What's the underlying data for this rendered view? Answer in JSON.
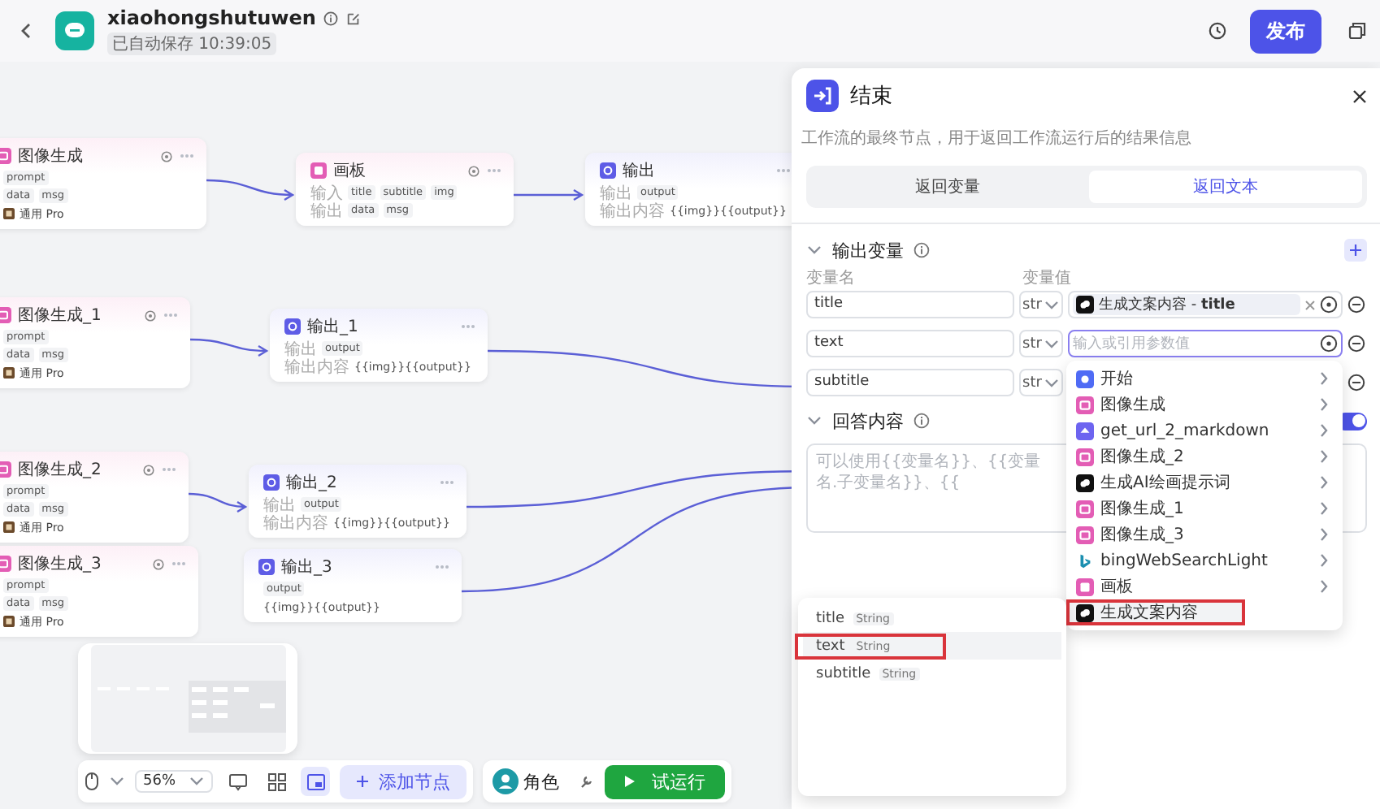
{
  "header": {
    "title": "xiaohongshutuwen",
    "save_status": "已自动保存 10:39:05",
    "publish_button": "发布"
  },
  "canvas": {
    "nodes": [
      {
        "kind": "image",
        "title": "图像生成",
        "rows": [
          {
            "kind": "tags",
            "tags": [
              "prompt"
            ]
          },
          {
            "kind": "tags",
            "tags": [
              "data",
              "msg"
            ]
          },
          {
            "kind": "model",
            "text": "通用 Pro"
          }
        ]
      },
      {
        "kind": "board",
        "title": "画板",
        "rows": [
          {
            "kind": "tags",
            "label": "输入",
            "tags": [
              "title",
              "subtitle",
              "img"
            ]
          },
          {
            "kind": "tags",
            "label": "输出",
            "tags": [
              "data",
              "msg"
            ]
          }
        ]
      },
      {
        "kind": "output",
        "title": "输出",
        "rows": [
          {
            "kind": "tags",
            "label": "输出",
            "tags": [
              "output"
            ]
          },
          {
            "kind": "text",
            "label": "输出内容",
            "text": "{{img}}{{output}}"
          }
        ]
      },
      {
        "kind": "image",
        "title": "图像生成_1",
        "rows": [
          {
            "kind": "tags",
            "tags": [
              "prompt"
            ]
          },
          {
            "kind": "tags",
            "tags": [
              "data",
              "msg"
            ]
          },
          {
            "kind": "model",
            "text": "通用 Pro"
          }
        ]
      },
      {
        "kind": "output",
        "title": "输出_1",
        "rows": [
          {
            "kind": "tags",
            "label": "输出",
            "tags": [
              "output"
            ]
          },
          {
            "kind": "text",
            "label": "输出内容",
            "text": "{{img}}{{output}}"
          }
        ]
      },
      {
        "kind": "image",
        "title": "图像生成_2",
        "rows": [
          {
            "kind": "tags",
            "tags": [
              "prompt"
            ]
          },
          {
            "kind": "tags",
            "tags": [
              "data",
              "msg"
            ]
          },
          {
            "kind": "model",
            "text": "通用 Pro"
          }
        ]
      },
      {
        "kind": "output",
        "title": "输出_2",
        "rows": [
          {
            "kind": "tags",
            "label": "输出",
            "tags": [
              "output"
            ]
          },
          {
            "kind": "text",
            "label": "输出内容",
            "text": "{{img}}{{output}}"
          }
        ]
      },
      {
        "kind": "image",
        "title": "图像生成_3",
        "rows": [
          {
            "kind": "tags",
            "tags": [
              "prompt"
            ]
          },
          {
            "kind": "tags",
            "tags": [
              "data",
              "msg"
            ]
          },
          {
            "kind": "model",
            "text": "通用 Pro"
          }
        ]
      },
      {
        "kind": "output",
        "title": "输出_3",
        "rows": [
          {
            "kind": "tags",
            "tags": [
              "output"
            ]
          },
          {
            "kind": "text",
            "text": "{{img}}{{output}}"
          }
        ]
      }
    ]
  },
  "panel": {
    "title": "结束",
    "description": "工作流的最终节点，用于返回工作流运行后的结果信息",
    "tabs": [
      {
        "label": "返回变量",
        "selected": false
      },
      {
        "label": "返回文本",
        "selected": true
      }
    ],
    "output_section": {
      "title": "输出变量",
      "expanded": true,
      "column_name": "变量名",
      "column_value": "变量值",
      "rows": [
        {
          "name": "title",
          "type": "str",
          "value": {
            "kind": "reference",
            "text": "生成文案内容 - **title**"
          }
        },
        {
          "name": "text",
          "type": "str",
          "value": {
            "kind": "input",
            "placeholder": "输入或引用参数值",
            "focused": true
          }
        },
        {
          "name": "subtitle",
          "type": "str"
        }
      ]
    },
    "answer_section": {
      "title": "回答内容",
      "expanded": true,
      "enabled": true,
      "placeholder": "可以使用{{变量名}}、{{变量名.子变量名}}、{{"
    }
  },
  "node_menu": [
    {
      "kind": "start",
      "label": "开始",
      "selected": false,
      "marked": false
    },
    {
      "kind": "image",
      "label": "图像生成",
      "selected": false,
      "marked": false
    },
    {
      "kind": "plugin",
      "label": "get_url_2_markdown",
      "selected": false,
      "marked": false
    },
    {
      "kind": "image",
      "label": "图像生成_2",
      "selected": false,
      "marked": false
    },
    {
      "kind": "llm",
      "label": "生成AI绘画提示词",
      "selected": false,
      "marked": false
    },
    {
      "kind": "image",
      "label": "图像生成_1",
      "selected": false,
      "marked": false
    },
    {
      "kind": "image",
      "label": "图像生成_3",
      "selected": false,
      "marked": false
    },
    {
      "kind": "bing",
      "label": "bingWebSearchLight",
      "selected": false,
      "marked": false
    },
    {
      "kind": "board",
      "label": "画板",
      "selected": false,
      "marked": false
    },
    {
      "kind": "llm",
      "label": "生成文案内容",
      "selected": true,
      "marked": true
    }
  ],
  "variable_menu": [
    {
      "name": "title",
      "type": "String",
      "selected": false,
      "marked": false
    },
    {
      "name": "text",
      "type": "String",
      "selected": true,
      "marked": true
    },
    {
      "name": "subtitle",
      "type": "String",
      "selected": false,
      "marked": false
    }
  ],
  "toolbar": {
    "zoom": "56%",
    "tools": [
      {
        "kind": "comment",
        "selected": false
      },
      {
        "kind": "grid",
        "selected": false
      },
      {
        "kind": "minimap",
        "selected": true
      }
    ],
    "add_node": "添加节点",
    "role": "角色",
    "run": "试运行"
  }
}
